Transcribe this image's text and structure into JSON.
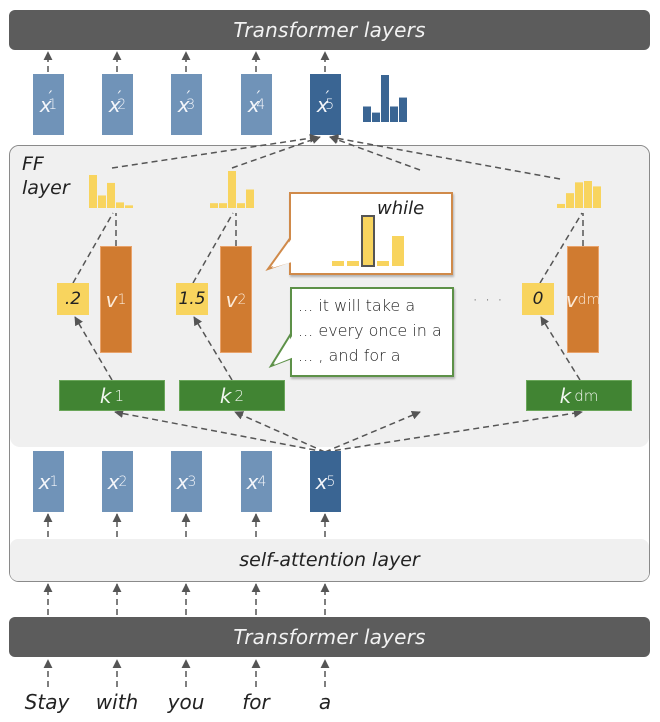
{
  "top_bar": {
    "label": "Transformer layers"
  },
  "bottom_bar": {
    "label": "Transformer layers"
  },
  "self_attention": {
    "label": "self-attention layer"
  },
  "ff_layer": {
    "label_line1": "FF",
    "label_line2": "layer"
  },
  "outputs": [
    {
      "sym": "x",
      "prime": "′",
      "sub": "1",
      "highlighted": false
    },
    {
      "sym": "x",
      "prime": "′",
      "sub": "2",
      "highlighted": false
    },
    {
      "sym": "x",
      "prime": "′",
      "sub": "3",
      "highlighted": false
    },
    {
      "sym": "x",
      "prime": "′",
      "sub": "4",
      "highlighted": false
    },
    {
      "sym": "x",
      "prime": "′",
      "sub": "5",
      "highlighted": true
    }
  ],
  "inputs": [
    {
      "sym": "x",
      "sub": "1",
      "highlighted": false
    },
    {
      "sym": "x",
      "sub": "2",
      "highlighted": false
    },
    {
      "sym": "x",
      "sub": "3",
      "highlighted": false
    },
    {
      "sym": "x",
      "sub": "4",
      "highlighted": false
    },
    {
      "sym": "x",
      "sub": "5",
      "highlighted": true
    }
  ],
  "tokens": [
    "Stay",
    "with",
    "you",
    "for",
    "a"
  ],
  "memories": [
    {
      "value_sym": "v",
      "value_sub": "1",
      "key_sym": "k",
      "key_sub": "1",
      "coefficient": ".2",
      "distribution": [
        1.0,
        0.38,
        0.76,
        0.17,
        0.08
      ]
    },
    {
      "value_sym": "v",
      "value_sub": "2",
      "key_sym": "k",
      "key_sub": "2",
      "coefficient": "1.5",
      "distribution": [
        0.13,
        0.13,
        1.0,
        0.13,
        0.5
      ]
    },
    {
      "value_sym": "v",
      "value_sub": "dm",
      "key_sym": "k",
      "key_sub": "dm",
      "coefficient": "0",
      "distribution": [
        0.15,
        0.55,
        0.95,
        1.0,
        0.8
      ]
    }
  ],
  "ellipsis": "···",
  "output_distribution": [
    0.33,
    0.2,
    1.0,
    0.33,
    0.52
  ],
  "value_callout": {
    "word": "while",
    "distribution": [
      0.1,
      0.1,
      1.0,
      0.1,
      0.6
    ],
    "highlighted_index": 2
  },
  "key_callout": {
    "lines": [
      "... it will take a",
      "... every once in a",
      "... , and for a"
    ]
  },
  "colors": {
    "transformer_bar": "#5c5c5c",
    "input_box": "#7093b8",
    "input_box_highlight": "#3a6593",
    "value_box": "#d07b30",
    "key_box": "#418433",
    "coefficient": "#f8d45e",
    "panel": "#f0f0f0",
    "arrow": "#555555"
  }
}
